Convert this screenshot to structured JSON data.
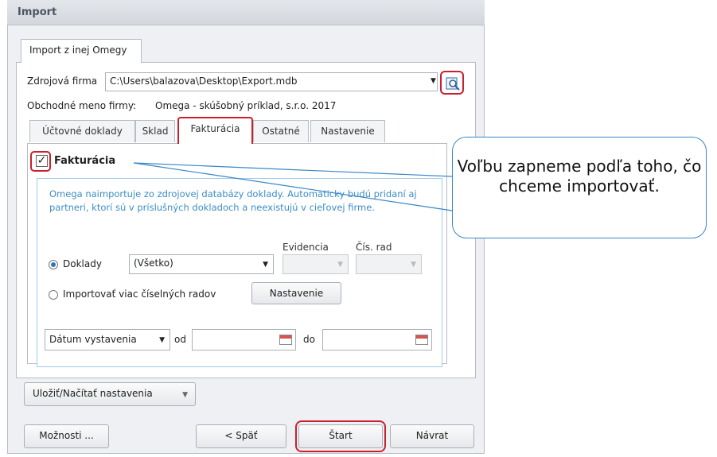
{
  "window": {
    "title": "Import"
  },
  "outer_tab": {
    "label": "Import z inej Omegy"
  },
  "source": {
    "label": "Zdrojová firma",
    "value": "C:\\Users\\balazova\\Desktop\\Export.mdb",
    "company_label": "Obchodné meno firmy:",
    "company_value": "Omega - skúšobný príklad, s.r.o. 2017"
  },
  "subtabs": [
    "Účtovné doklady",
    "Sklad",
    "Fakturácia",
    "Ostatné",
    "Nastavenie"
  ],
  "section": {
    "checkbox_label": "Fakturácia",
    "description": "Omega naimportuje zo zdrojovej databázy doklady. Automaticky budú pridaní aj partneri, ktorí sú v príslušných dokladoch a neexistujú v cieľovej firme.",
    "col_evidencia": "Evidencia",
    "col_cis_rad": "Čís. rad",
    "radio_doklady": "Doklady",
    "doklady_value": "(Všetko)",
    "radio_viac": "Importovať viac číselných radov",
    "nastavenie_button": "Nastavenie",
    "date_type": "Dátum vystavenia",
    "od": "od",
    "do": "do"
  },
  "buttons": {
    "save_load": "Uložiť/Načítať nastavenia",
    "options": "Možnosti ...",
    "back": "< Späť",
    "start": "Štart",
    "return": "Návrat"
  },
  "callout": {
    "text": "Voľbu zapneme podľa toho, čo chceme importovať."
  },
  "colors": {
    "highlight": "#c9202c",
    "accent_blue": "#3b8dc7"
  }
}
